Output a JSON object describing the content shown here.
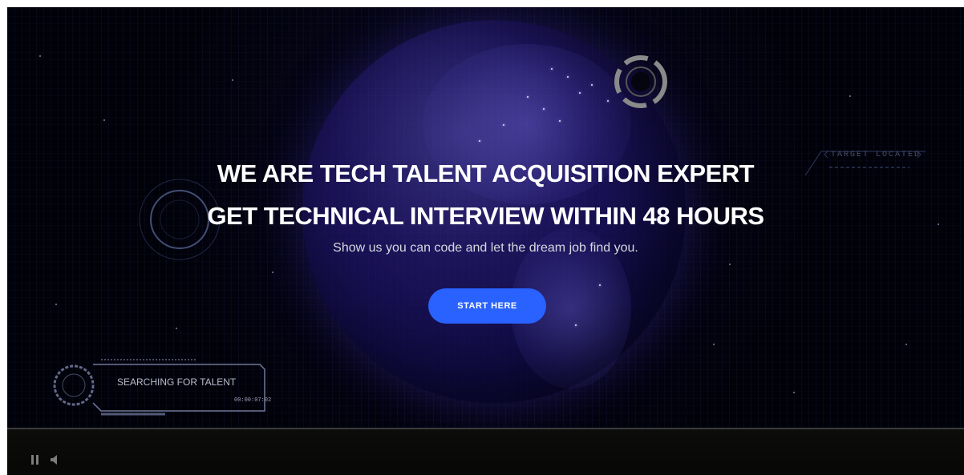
{
  "hero": {
    "headline_line1": "WE ARE TECH TALENT ACQUISITION EXPERT",
    "headline_line2": "GET TECHNICAL INTERVIEW WITHIN 48 HOURS",
    "subtitle": "Show us you can code and let the dream job find you.",
    "cta_label": "START HERE"
  },
  "hud": {
    "target_label": "TARGET LOCATED",
    "panel_label": "SEARCHING FOR TALENT",
    "panel_timer": "00:00:07:02"
  },
  "video_controls": {
    "pause_icon": "pause-icon",
    "volume_icon": "volume-icon"
  },
  "colors": {
    "cta": "#2962ff",
    "background": "#01010a",
    "globe": "#2d1e8c"
  }
}
